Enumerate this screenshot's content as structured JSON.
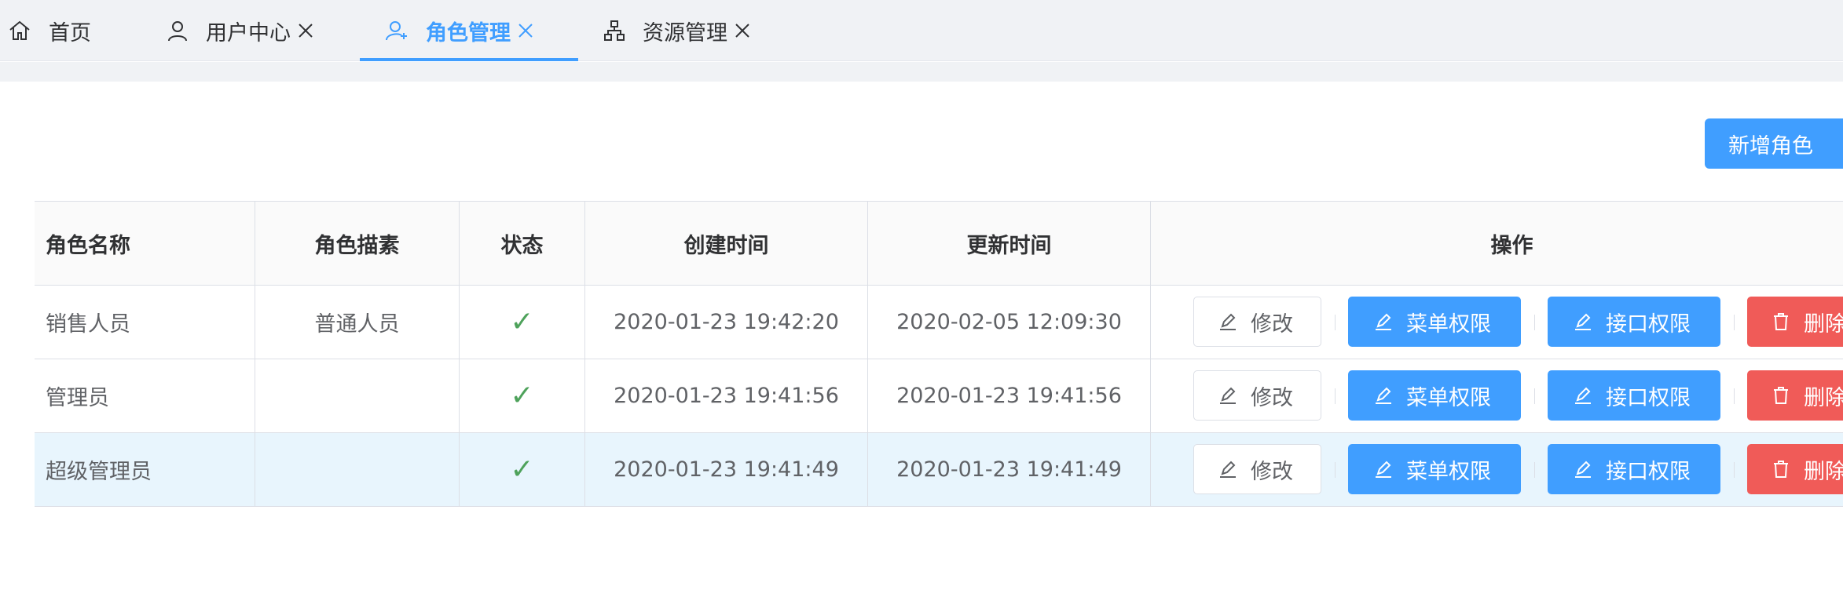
{
  "tabs": [
    {
      "label": "首页",
      "icon": "home-icon",
      "closable": false,
      "active": false
    },
    {
      "label": "用户中心",
      "icon": "user-icon",
      "closable": true,
      "active": false
    },
    {
      "label": "角色管理",
      "icon": "role-icon",
      "closable": true,
      "active": true
    },
    {
      "label": "资源管理",
      "icon": "sitemap-icon",
      "closable": true,
      "active": false
    }
  ],
  "toolbar": {
    "add_label": "新增角色"
  },
  "table": {
    "columns": [
      "角色名称",
      "角色描素",
      "状态",
      "创建时间",
      "更新时间",
      "操作"
    ],
    "rows": [
      {
        "name": "销售人员",
        "desc": "普通人员",
        "status": "enabled",
        "created": "2020-01-23 19:42:20",
        "updated": "2020-02-05 12:09:30"
      },
      {
        "name": "管理员",
        "desc": "",
        "status": "enabled",
        "created": "2020-01-23 19:41:56",
        "updated": "2020-01-23 19:41:56"
      },
      {
        "name": "超级管理员",
        "desc": "",
        "status": "enabled",
        "created": "2020-01-23 19:41:49",
        "updated": "2020-01-23 19:41:49"
      }
    ],
    "actions": {
      "edit": "修改",
      "menu_perm": "菜单权限",
      "api_perm": "接口权限",
      "delete": "删除"
    },
    "status_glyph": "✓"
  },
  "colors": {
    "primary": "#409eff",
    "danger": "#f05b58",
    "success": "#4ea25b",
    "highlight_row": "#e8f5fd"
  }
}
